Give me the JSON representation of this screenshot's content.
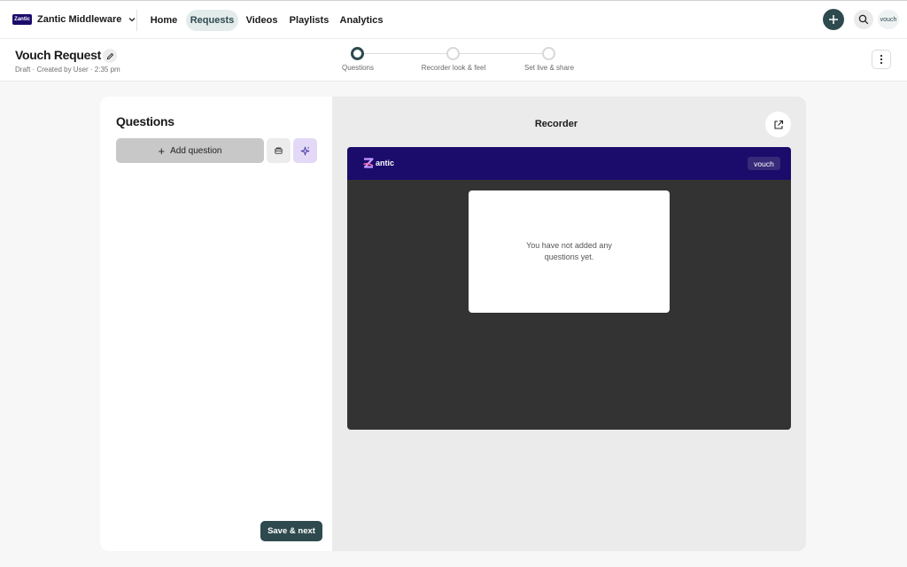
{
  "org": {
    "name": "Zantic Middleware",
    "logo_text": "Zantic"
  },
  "nav": {
    "items": [
      {
        "label": "Home"
      },
      {
        "label": "Requests",
        "active": true
      },
      {
        "label": "Videos"
      },
      {
        "label": "Playlists"
      },
      {
        "label": "Analytics"
      }
    ]
  },
  "top_actions": {
    "plus_icon": "plus-icon",
    "search_icon": "search-icon",
    "avatar_text": "vouch"
  },
  "header": {
    "title": "Vouch Request",
    "subtitle": "Draft · Created by User · 2:35 pm",
    "steps": [
      {
        "label": "Questions",
        "active": true
      },
      {
        "label": "Recorder look & feel",
        "active": false
      },
      {
        "label": "Set live & share",
        "active": false
      }
    ]
  },
  "questions_panel": {
    "title": "Questions",
    "add_label": "Add question",
    "save_label": "Save & next"
  },
  "recorder": {
    "title": "Recorder",
    "brand_text": "antic",
    "badge": "vouch",
    "empty_text": "You have not added any questions yet."
  },
  "colors": {
    "accent": "#2e4a4f",
    "brand_header": "#1b0b6b",
    "ai_button": "#e3d9f7",
    "preview_bg": "#333333"
  }
}
